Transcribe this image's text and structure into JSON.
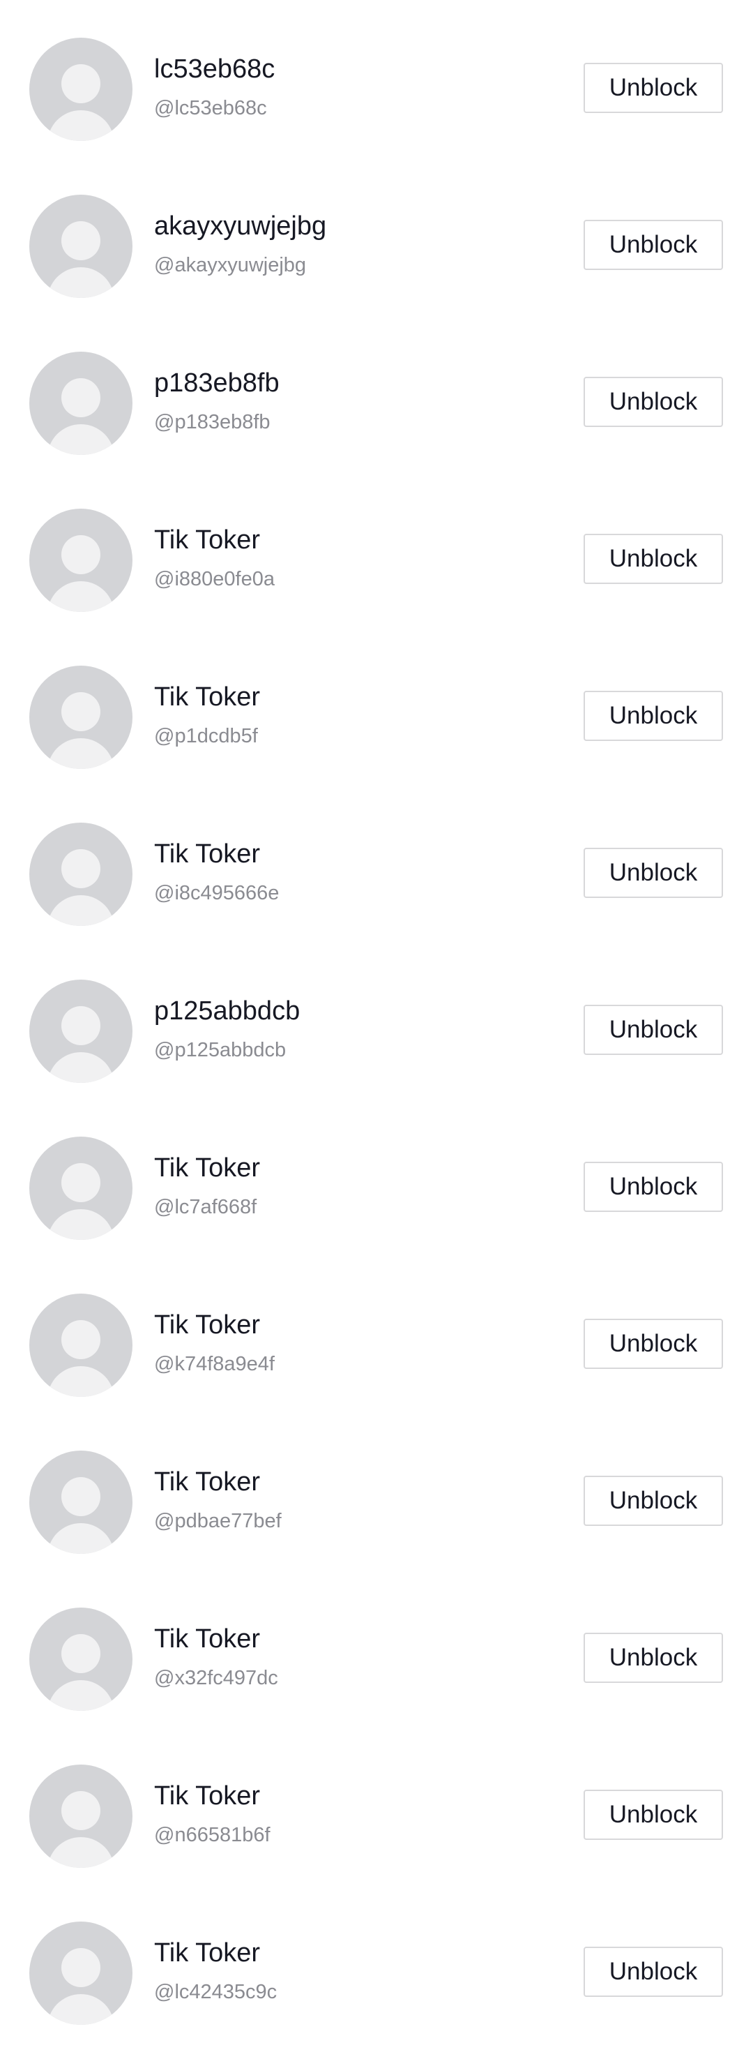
{
  "blocked_accounts": [
    {
      "name": "lc53eb68c",
      "handle": "@lc53eb68c",
      "button": "Unblock"
    },
    {
      "name": "akayxyuwjejbg",
      "handle": "@akayxyuwjejbg",
      "button": "Unblock"
    },
    {
      "name": "p183eb8fb",
      "handle": "@p183eb8fb",
      "button": "Unblock"
    },
    {
      "name": "Tik Toker",
      "handle": "@i880e0fe0a",
      "button": "Unblock"
    },
    {
      "name": "Tik Toker",
      "handle": "@p1dcdb5f",
      "button": "Unblock"
    },
    {
      "name": "Tik Toker",
      "handle": "@i8c495666e",
      "button": "Unblock"
    },
    {
      "name": "p125abbdcb",
      "handle": "@p125abbdcb",
      "button": "Unblock"
    },
    {
      "name": "Tik Toker",
      "handle": "@lc7af668f",
      "button": "Unblock"
    },
    {
      "name": "Tik Toker",
      "handle": "@k74f8a9e4f",
      "button": "Unblock"
    },
    {
      "name": "Tik Toker",
      "handle": "@pdbae77bef",
      "button": "Unblock"
    },
    {
      "name": "Tik Toker",
      "handle": "@x32fc497dc",
      "button": "Unblock"
    },
    {
      "name": "Tik Toker",
      "handle": "@n66581b6f",
      "button": "Unblock"
    },
    {
      "name": "Tik Toker",
      "handle": "@lc42435c9c",
      "button": "Unblock"
    }
  ],
  "colors": {
    "name_text": "#161823",
    "handle_text": "#8a8b91",
    "avatar_bg": "#d3d4d7",
    "avatar_figure": "#f1f1f2",
    "button_border": "#d8d8da"
  },
  "icons": {
    "avatar": "default-avatar-icon"
  }
}
